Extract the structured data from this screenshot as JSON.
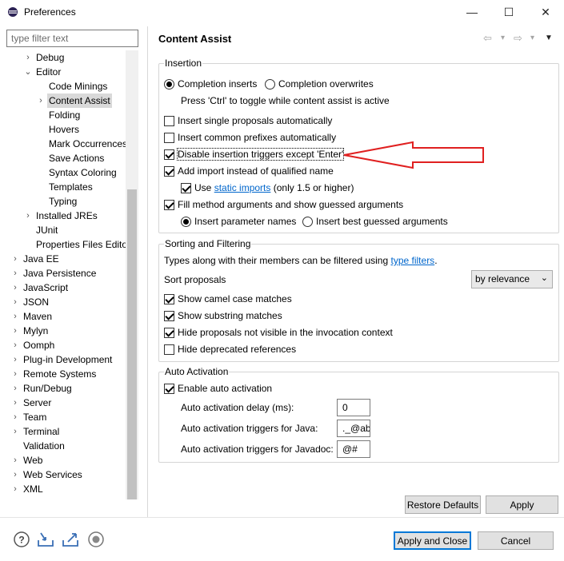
{
  "window": {
    "title": "Preferences",
    "minimize_glyph": "—",
    "maximize_glyph": "☐",
    "close_glyph": "✕"
  },
  "filter": {
    "placeholder": "type filter text",
    "value": ""
  },
  "tree": [
    {
      "label": "Debug",
      "chevron": "›",
      "selected": false
    },
    {
      "label": "Editor",
      "chevron": "⌄",
      "selected": false
    },
    {
      "label": "Code Minings",
      "chevron": "",
      "selected": false
    },
    {
      "label": "Content Assist",
      "chevron": "›",
      "selected": true
    },
    {
      "label": "Folding",
      "chevron": "",
      "selected": false
    },
    {
      "label": "Hovers",
      "chevron": "",
      "selected": false
    },
    {
      "label": "Mark Occurrences",
      "chevron": "",
      "selected": false
    },
    {
      "label": "Save Actions",
      "chevron": "",
      "selected": false
    },
    {
      "label": "Syntax Coloring",
      "chevron": "",
      "selected": false
    },
    {
      "label": "Templates",
      "chevron": "",
      "selected": false
    },
    {
      "label": "Typing",
      "chevron": "",
      "selected": false
    },
    {
      "label": "Installed JREs",
      "chevron": "›",
      "selected": false
    },
    {
      "label": "JUnit",
      "chevron": "",
      "selected": false
    },
    {
      "label": "Properties Files Editor",
      "chevron": "",
      "selected": false
    },
    {
      "label": "Java EE",
      "chevron": "›",
      "selected": false
    },
    {
      "label": "Java Persistence",
      "chevron": "›",
      "selected": false
    },
    {
      "label": "JavaScript",
      "chevron": "›",
      "selected": false
    },
    {
      "label": "JSON",
      "chevron": "›",
      "selected": false
    },
    {
      "label": "Maven",
      "chevron": "›",
      "selected": false
    },
    {
      "label": "Mylyn",
      "chevron": "›",
      "selected": false
    },
    {
      "label": "Oomph",
      "chevron": "›",
      "selected": false
    },
    {
      "label": "Plug-in Development",
      "chevron": "›",
      "selected": false
    },
    {
      "label": "Remote Systems",
      "chevron": "›",
      "selected": false
    },
    {
      "label": "Run/Debug",
      "chevron": "›",
      "selected": false
    },
    {
      "label": "Server",
      "chevron": "›",
      "selected": false
    },
    {
      "label": "Team",
      "chevron": "›",
      "selected": false
    },
    {
      "label": "Terminal",
      "chevron": "›",
      "selected": false
    },
    {
      "label": "Validation",
      "chevron": "",
      "selected": false
    },
    {
      "label": "Web",
      "chevron": "›",
      "selected": false
    },
    {
      "label": "Web Services",
      "chevron": "›",
      "selected": false
    },
    {
      "label": "XML",
      "chevron": "›",
      "selected": false
    }
  ],
  "page": {
    "title": "Content Assist",
    "nav_back_glyph": "⇦",
    "nav_forward_glyph": "⇨",
    "nav_dropdown_glyph": "▾",
    "menu_glyph": "▼"
  },
  "insertion": {
    "label": "Insertion",
    "completion_inserts": "Completion inserts",
    "completion_overwrites": "Completion overwrites",
    "toggle_hint": "Press 'Ctrl' to toggle while content assist is active",
    "single_proposals": "Insert single proposals automatically",
    "common_prefixes": "Insert common prefixes automatically",
    "disable_triggers": "Disable insertion triggers except 'Enter'",
    "add_import": "Add import instead of qualified name",
    "use_prefix": "Use",
    "static_imports": "static imports",
    "static_suffix": "(only 1.5 or higher)",
    "fill_arguments": "Fill method arguments and show guessed arguments",
    "insert_param_names": "Insert parameter names",
    "insert_best_guessed": "Insert best guessed arguments"
  },
  "sorting": {
    "label": "Sorting and Filtering",
    "types_text": "Types along with their members can be filtered using",
    "type_filters": "type filters",
    "period": ".",
    "sort_proposals": "Sort proposals",
    "sort_value": "by relevance",
    "camel_case": "Show camel case matches",
    "substring": "Show substring matches",
    "hide_not_visible": "Hide proposals not visible in the invocation context",
    "hide_deprecated": "Hide deprecated references"
  },
  "auto_activation": {
    "label": "Auto Activation",
    "enable": "Enable auto activation",
    "delay_label": "Auto activation delay (ms):",
    "delay_value": "0",
    "java_label": "Auto activation triggers for Java:",
    "java_value": "._@ab",
    "javadoc_label": "Auto activation triggers for Javadoc:",
    "javadoc_value": "@#"
  },
  "buttons": {
    "restore_defaults": "Restore Defaults",
    "apply": "Apply",
    "apply_and_close": "Apply and Close",
    "cancel": "Cancel"
  },
  "colors": {
    "annotation_arrow": "#e02020",
    "link": "#0066cc",
    "selection": "#d9d9d9"
  }
}
